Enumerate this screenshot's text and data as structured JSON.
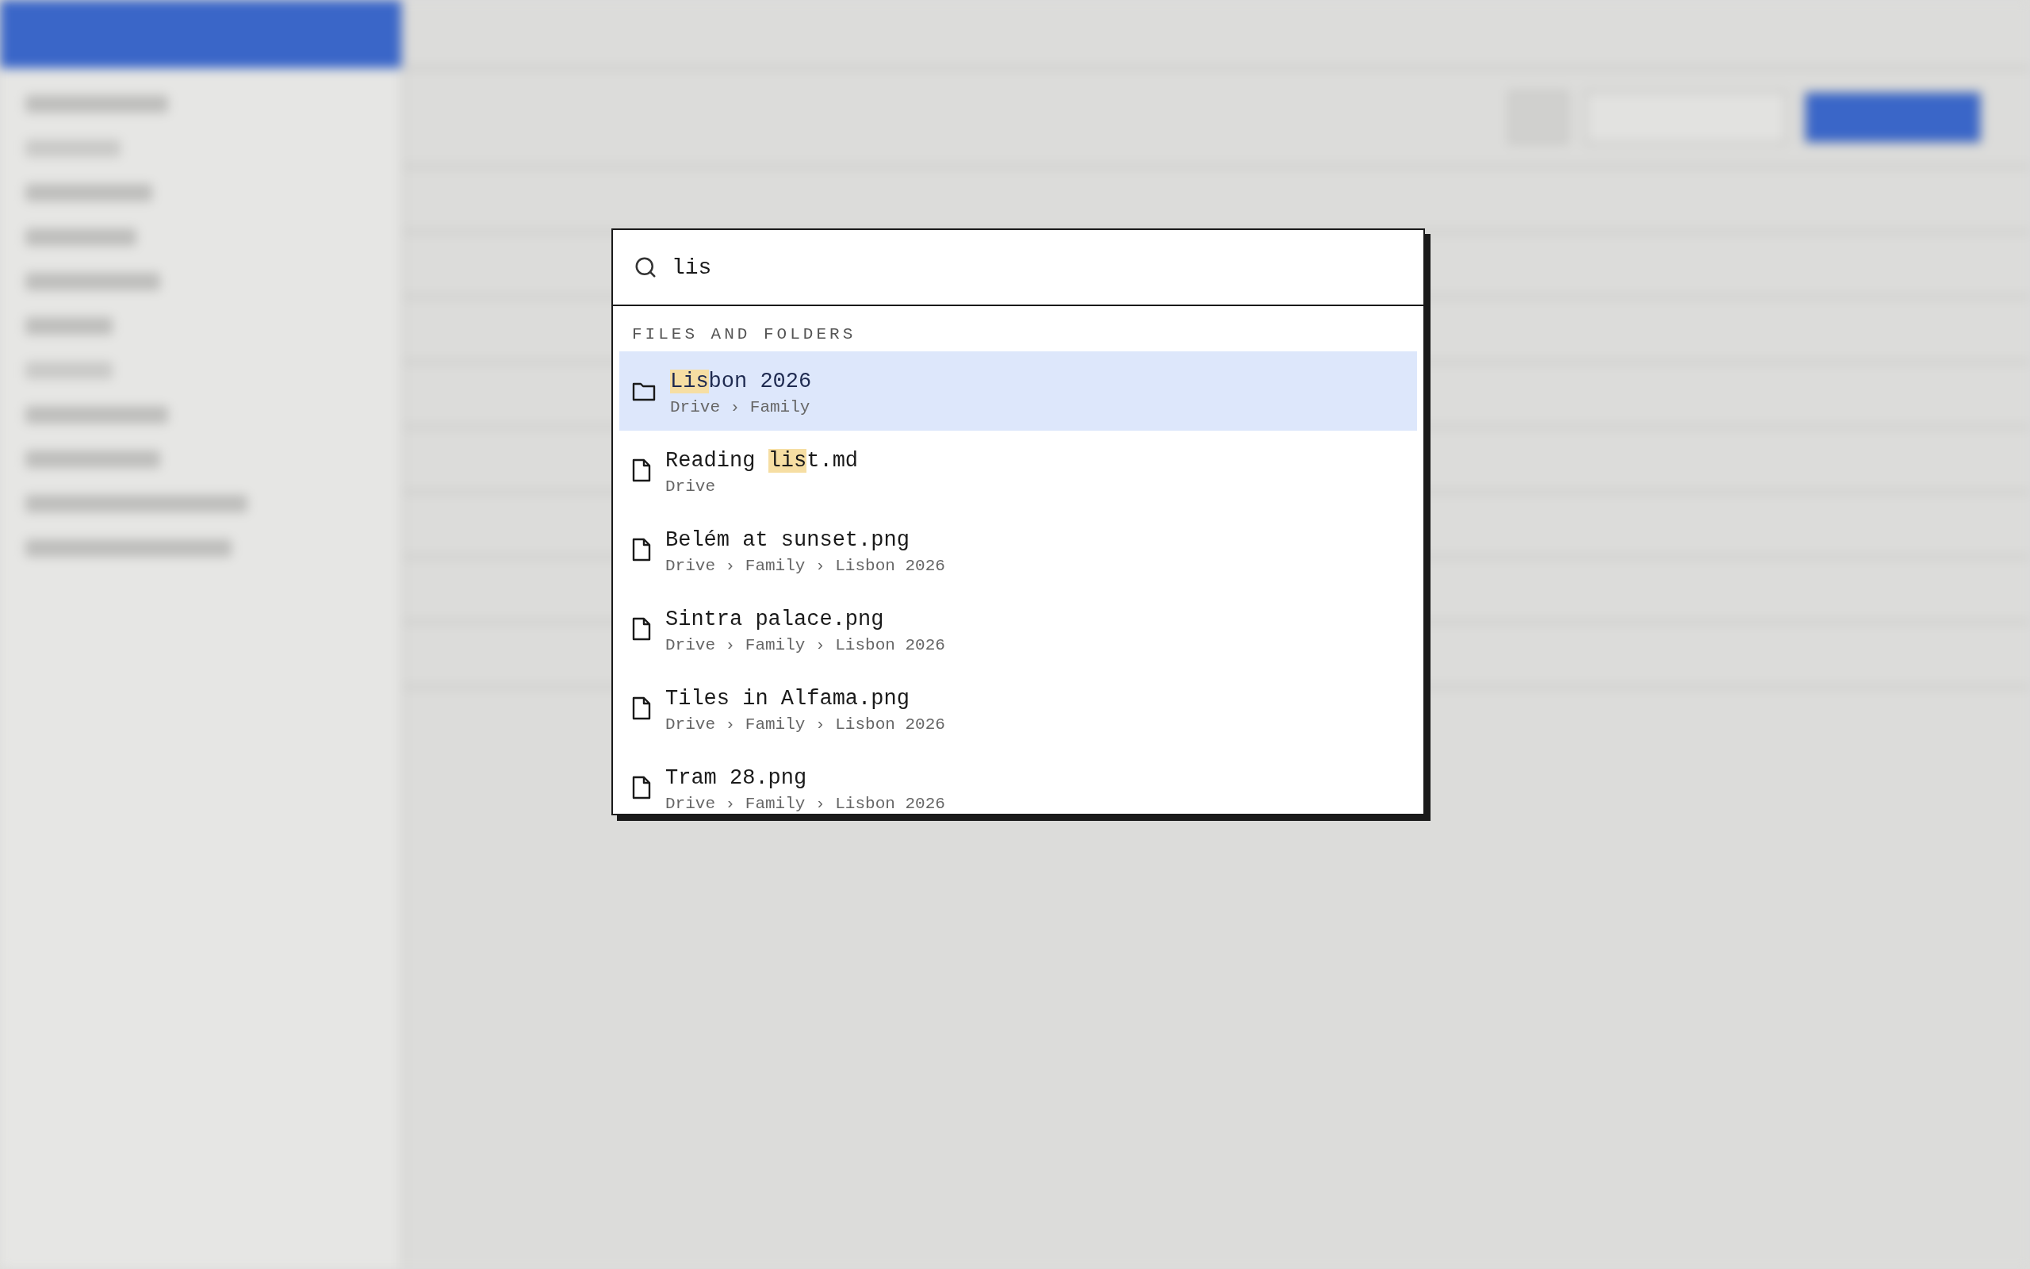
{
  "search": {
    "value": "lis"
  },
  "section": "FILES AND FOLDERS",
  "results": [
    {
      "kind": "folder",
      "selected": true,
      "name": [
        {
          "text": "Lis",
          "match": true
        },
        {
          "text": "bon 2026",
          "match": false
        }
      ],
      "path": [
        "Drive",
        "Family"
      ]
    },
    {
      "kind": "file",
      "selected": false,
      "name": [
        {
          "text": "Reading ",
          "match": false
        },
        {
          "text": "lis",
          "match": true
        },
        {
          "text": "t.md",
          "match": false
        }
      ],
      "path": [
        "Drive"
      ]
    },
    {
      "kind": "file",
      "selected": false,
      "name": [
        {
          "text": "Belém at sunset.png",
          "match": false
        }
      ],
      "path": [
        "Drive",
        "Family",
        "Lisbon 2026"
      ]
    },
    {
      "kind": "file",
      "selected": false,
      "name": [
        {
          "text": "Sintra palace.png",
          "match": false
        }
      ],
      "path": [
        "Drive",
        "Family",
        "Lisbon 2026"
      ]
    },
    {
      "kind": "file",
      "selected": false,
      "name": [
        {
          "text": "Tiles in Alfama.png",
          "match": false
        }
      ],
      "path": [
        "Drive",
        "Family",
        "Lisbon 2026"
      ]
    },
    {
      "kind": "file",
      "selected": false,
      "name": [
        {
          "text": "Tram 28.png",
          "match": false
        }
      ],
      "path": [
        "Drive",
        "Family",
        "Lisbon 2026"
      ]
    }
  ],
  "separator": "›"
}
